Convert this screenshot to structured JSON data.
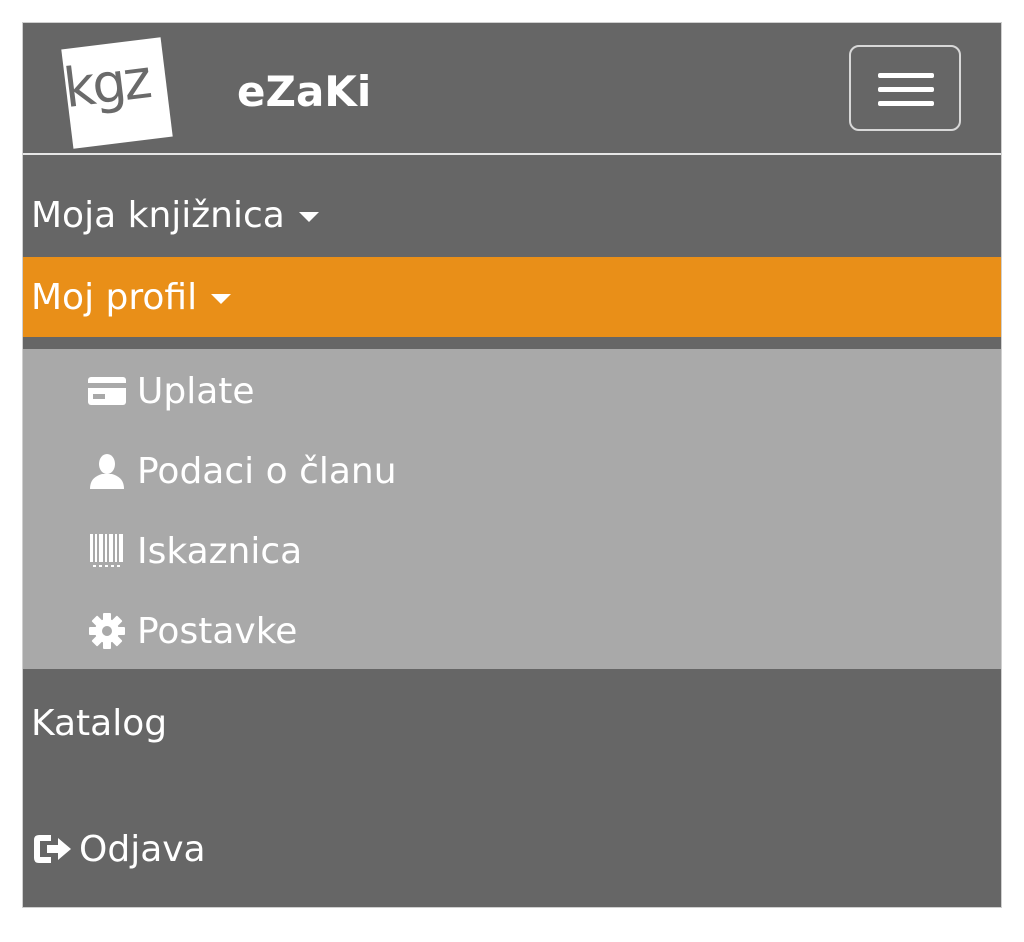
{
  "brand": {
    "logo_text": "kgz",
    "title": "eZaKi"
  },
  "header": {
    "menu_toggle_icon": "hamburger-icon"
  },
  "nav": {
    "library": {
      "label": "Moja knjižnica",
      "icon": "caret-down-icon"
    },
    "profile": {
      "label": "Moj profil",
      "icon": "caret-down-icon",
      "active_color": "#e98f18",
      "submenu": [
        {
          "label": "Uplate",
          "icon": "credit-card-icon"
        },
        {
          "label": "Podaci o članu",
          "icon": "user-icon"
        },
        {
          "label": "Iskaznica",
          "icon": "barcode-icon"
        },
        {
          "label": "Postavke",
          "icon": "gear-icon"
        }
      ]
    },
    "katalog": {
      "label": "Katalog"
    },
    "logout": {
      "label": "Odjava",
      "icon": "logout-icon"
    }
  },
  "colors": {
    "navbar_bg": "#666666",
    "submenu_bg": "#a9a9a9",
    "text": "#ffffff"
  }
}
